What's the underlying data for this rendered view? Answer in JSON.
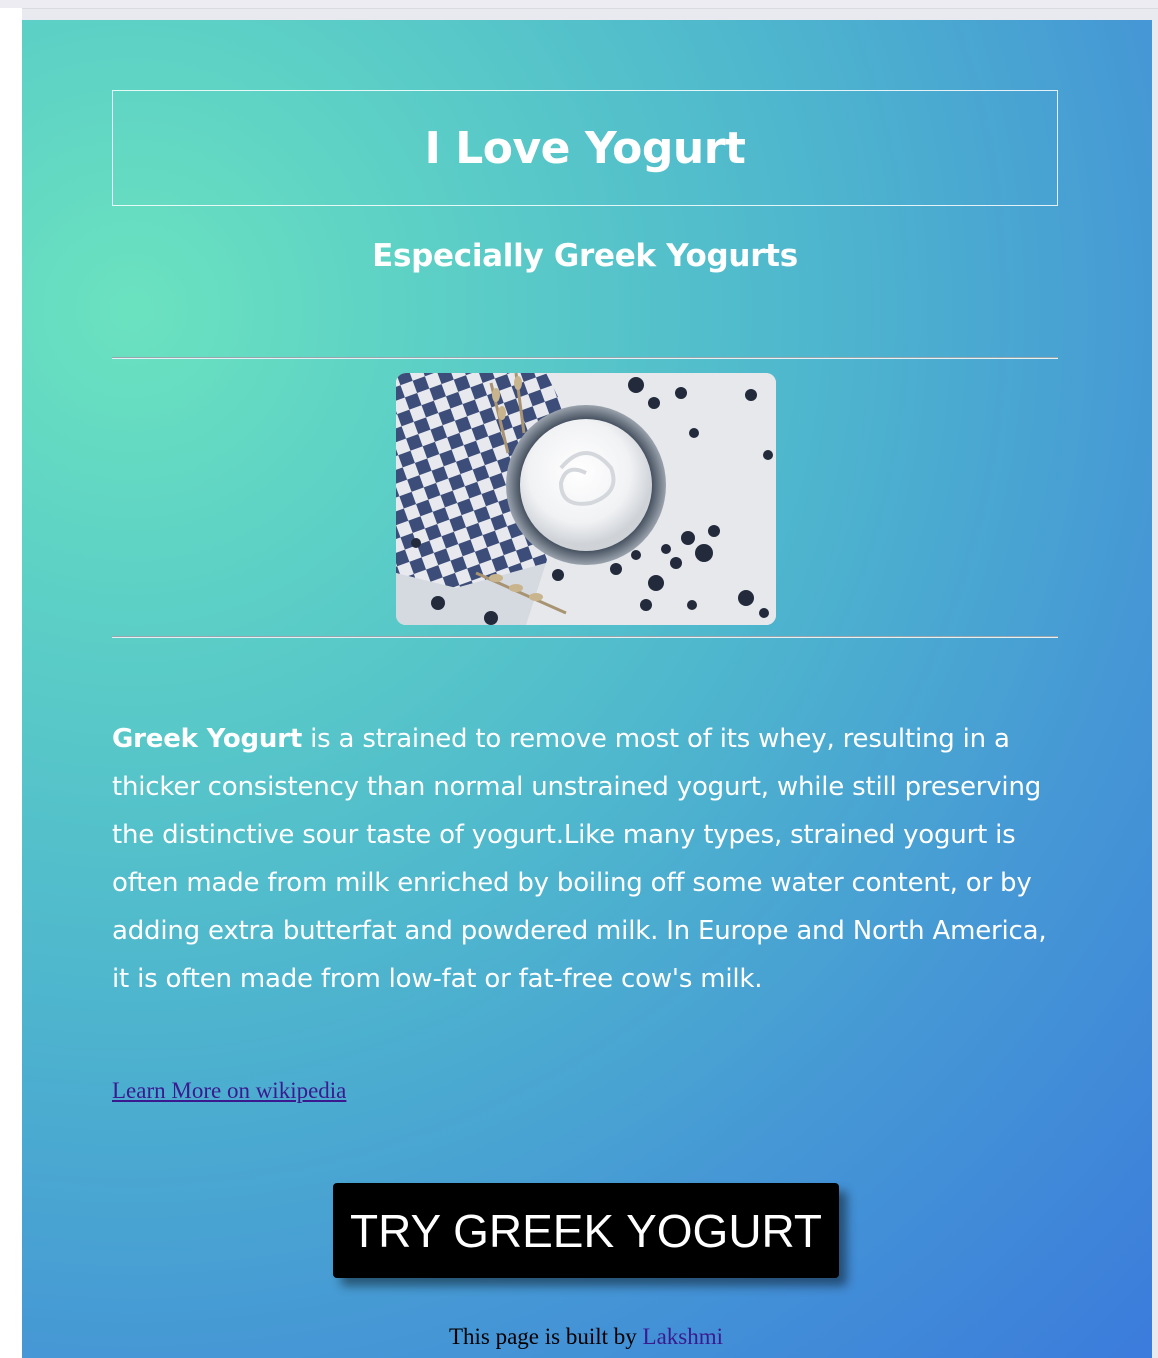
{
  "header": {
    "title": "I Love Yogurt",
    "subtitle": "Especially Greek Yogurts"
  },
  "image": {
    "alt": "Bowl of greek yogurt with blueberries",
    "description_icon": "yogurt-photo"
  },
  "article": {
    "bold_lead": "Greek Yogurt",
    "text": " is a strained to remove most of its whey, resulting in a thicker consistency than normal unstrained yogurt, while still preserving the distinctive sour taste of yogurt.Like many types, strained yogurt is often made from milk enriched by boiling off some water content, or by adding extra butterfat and powdered milk. In Europe and North America, it is often made from low-fat or fat-free cow's milk."
  },
  "link": {
    "label": "Learn More on wikipedia"
  },
  "cta": {
    "label": "TRY GREEK YOGURT"
  },
  "footer": {
    "prefix": "This page is built by ",
    "author": "Lakshmi"
  },
  "colors": {
    "gradient_start": "#6be2bf",
    "gradient_end": "#3b7bdc",
    "text": "#ffffff",
    "button_bg": "#000000",
    "link": "#3b1a8f"
  }
}
